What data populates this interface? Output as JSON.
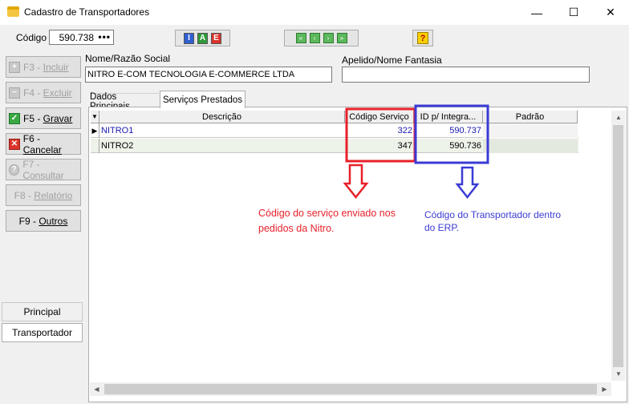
{
  "window": {
    "title": "Cadastro de Transportadores",
    "minimize_glyph": "—",
    "maximize_glyph": "☐",
    "close_glyph": "✕"
  },
  "toolbar": {
    "code_label": "Código",
    "code_value": "590.738",
    "code_ellipsis": "•••",
    "mode_buttons": [
      "I",
      "A",
      "E"
    ],
    "nav_buttons": [
      "«",
      "‹",
      "›",
      "»"
    ],
    "help_glyph": "?"
  },
  "sidebar": {
    "buttons": [
      {
        "key": "F3 - ",
        "label": "Incluir",
        "icon": "plus-icon",
        "glyph": "+"
      },
      {
        "key": "F4 - ",
        "label": "Excluir",
        "icon": "minus-icon",
        "glyph": "−"
      },
      {
        "key": "F5 - ",
        "label": "Gravar",
        "icon": "check-icon",
        "glyph": "✓"
      },
      {
        "key": "F6 - ",
        "label": "Cancelar",
        "icon": "x-icon",
        "glyph": "✕"
      },
      {
        "key": "F7 - ",
        "label": "Consultar",
        "icon": "question-icon",
        "glyph": "?"
      },
      {
        "key": "F8 - ",
        "label": "Relatório",
        "icon": "",
        "glyph": ""
      },
      {
        "key": "F9 - ",
        "label": "Outros",
        "icon": "",
        "glyph": ""
      }
    ],
    "tabs": [
      "Principal",
      "Transportador"
    ]
  },
  "form": {
    "name_label": "Nome/Razão Social",
    "name_value": "NITRO E-COM TECNOLOGIA E-COMMERCE LTDA",
    "alias_label": "Apelido/Nome Fantasia",
    "alias_value": ""
  },
  "tabs": [
    "Dados Principais",
    "Serviços Prestados"
  ],
  "grid": {
    "columns": [
      "Descrição",
      "Código Serviço",
      "ID p/ Integra...",
      "Padrão"
    ],
    "rows": [
      {
        "indicator": "▶",
        "description": "NITRO1",
        "service_code": "322",
        "integration_id": "590.737",
        "default": ""
      },
      {
        "indicator": "",
        "description": "NITRO2",
        "service_code": "347",
        "integration_id": "590.736",
        "default": ""
      }
    ]
  },
  "annotations": {
    "red_text_line1": "Código do serviço enviado nos",
    "red_text_line2": "pedidos da Nitro.",
    "blue_text_line1": "Código do Transportador dentro",
    "blue_text_line2": "do ERP."
  },
  "colors": {
    "red": "#e8202a",
    "blue": "#3b3bd6",
    "row_selected": "#ffffff",
    "row_alt": "#eef3ea"
  }
}
